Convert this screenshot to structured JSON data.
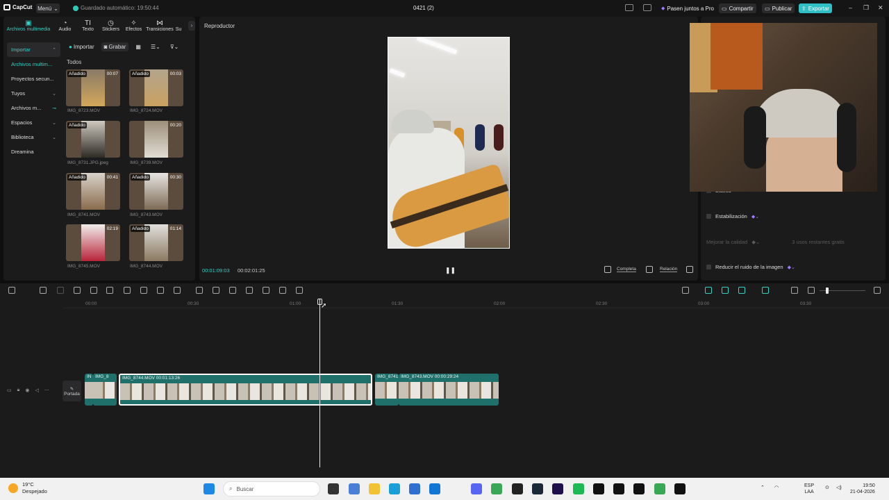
{
  "app": {
    "logo": "CapCut",
    "menu": "Menú",
    "autosave": "Guardado automático: 19:50:44",
    "project_title": "0421 (2)",
    "pro": "Pasen juntos a Pro",
    "share": "Compartir",
    "publish": "Publicar",
    "export": "Exportar",
    "accent": "#2fd4c7"
  },
  "tabs": [
    {
      "label": "Archivos multimedia",
      "icon": "media-icon"
    },
    {
      "label": "Audio",
      "icon": "audio-icon"
    },
    {
      "label": "Texto",
      "icon": "text-icon"
    },
    {
      "label": "Stickers",
      "icon": "sticker-icon"
    },
    {
      "label": "Efectos",
      "icon": "effects-icon"
    },
    {
      "label": "Transiciones",
      "icon": "transitions-icon"
    },
    {
      "label": "Su",
      "icon": "subtitles-icon"
    }
  ],
  "sidebar": [
    {
      "label": "Importar"
    },
    {
      "label": "Archivos multim..."
    },
    {
      "label": "Proyectos secun..."
    },
    {
      "label": "Tuyos"
    },
    {
      "label": "Archivos m..."
    },
    {
      "label": "Espacios"
    },
    {
      "label": "Biblioteca"
    },
    {
      "label": "Dreamina"
    }
  ],
  "media_toolbar": {
    "import": "Importar",
    "record": "Grabar"
  },
  "media": {
    "section": "Todos",
    "added": "Añadido",
    "items": [
      {
        "name": "IMG_8723.MOV",
        "duration": "00:07",
        "added": true
      },
      {
        "name": "IMG_8724.MOV",
        "duration": "00:03",
        "added": true
      },
      {
        "name": "IMG_8731.JPG.jpeg",
        "duration": "",
        "added": true
      },
      {
        "name": "IMG_8739.MOV",
        "duration": "00:20",
        "added": false
      },
      {
        "name": "IMG_8741.MOV",
        "duration": "00:41",
        "added": true
      },
      {
        "name": "IMG_8743.MOV",
        "duration": "00:30",
        "added": true
      },
      {
        "name": "IMG_8745.MOV",
        "duration": "02:19",
        "added": false
      },
      {
        "name": "IMG_8744.MOV",
        "duration": "01:14",
        "added": true
      }
    ]
  },
  "player": {
    "title": "Reproductor",
    "current": "00:01:09:03",
    "total": "00:02:01:25",
    "full": "Completa",
    "ratio": "Relación"
  },
  "right": {
    "basic": "Básica",
    "stabilization": "Estabilización",
    "quality": "Mejorar la calidad",
    "uses": "3 usos restantes gratis",
    "noise": "Reducir el ruido de la imagen"
  },
  "ruler": [
    "00:00",
    "00:30",
    "01:00",
    "01:30",
    "02:00",
    "02:30",
    "03:00",
    "03:30"
  ],
  "track": {
    "cover": "Portada",
    "clips": [
      {
        "label": "IN"
      },
      {
        "label": "IMG_8"
      },
      {
        "label": "IMG_8744.MOV   00:01:13:26"
      },
      {
        "label": "IMG_8741"
      },
      {
        "label": "IMG_8743.MOV   00:00:29:24"
      }
    ]
  },
  "taskbar": {
    "temp": "19°C",
    "weather": "Despejado",
    "search": "Buscar",
    "lang1": "ESP",
    "lang2": "LAA",
    "time": "19:50",
    "date": "21-04-2026"
  }
}
